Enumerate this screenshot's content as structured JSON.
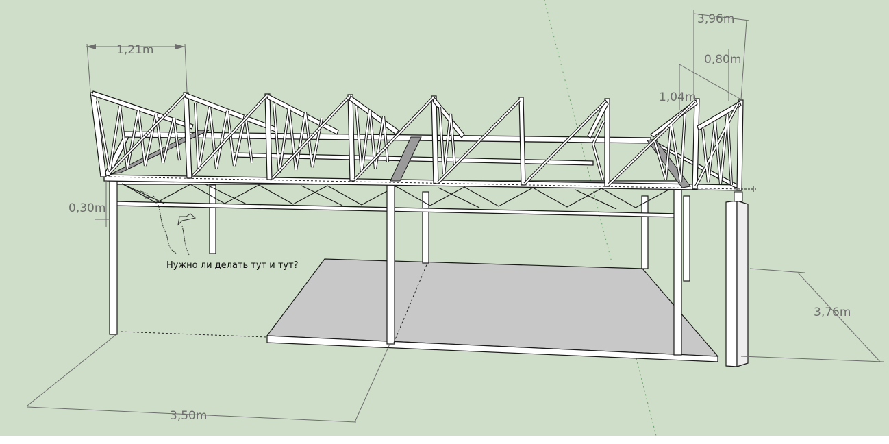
{
  "dimensions": {
    "top_width": "1,21m",
    "right_top": "3,96m",
    "right_mid": "0,80m",
    "right_side": "1,04m",
    "left_depth": "0,30m",
    "right_depth": "3,76m",
    "bottom_length": "3,50m"
  },
  "annotation": {
    "note": "Нужно ли делать тут и тут?"
  },
  "colors": {
    "background": "#cfdec8",
    "members": "#ffffff",
    "outline": "#1a1a1a",
    "floor": "#c8c8c8",
    "dimension_text": "#6e6e6e"
  }
}
